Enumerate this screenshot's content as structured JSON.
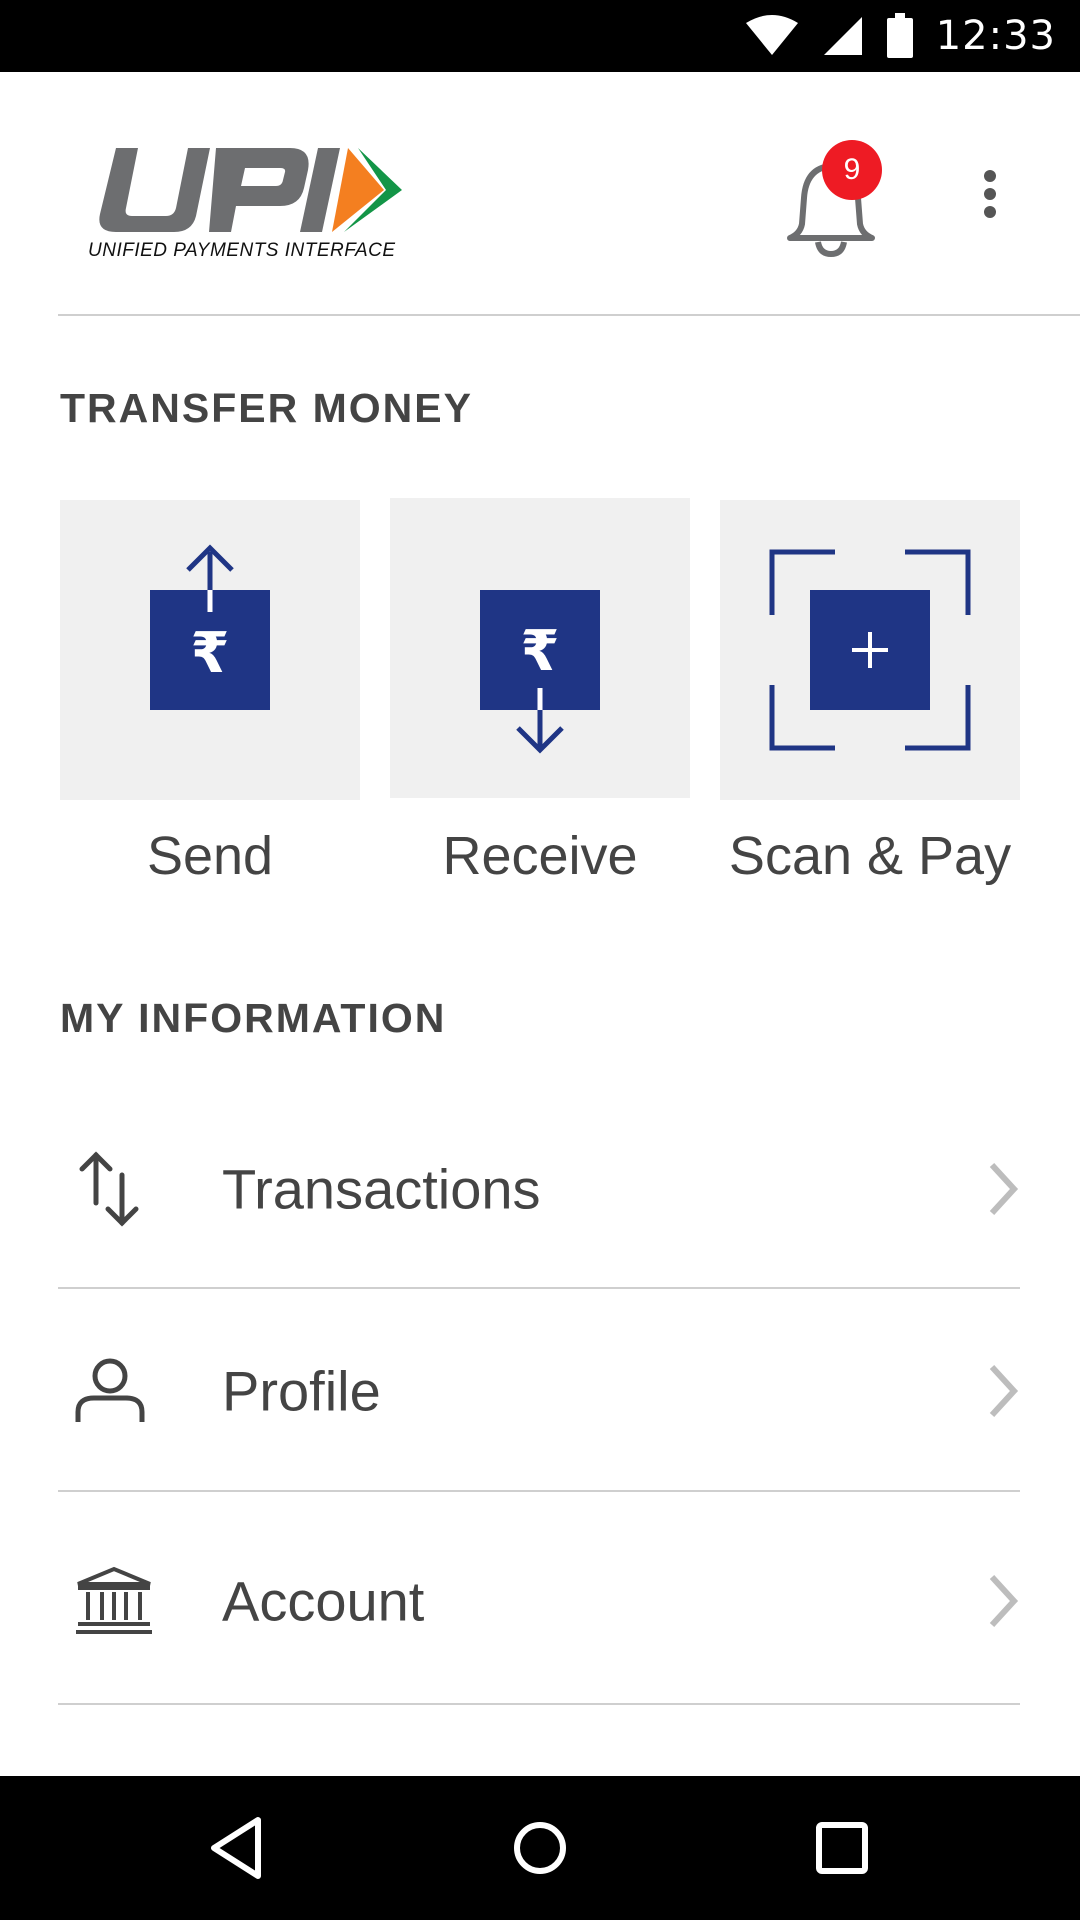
{
  "status_bar": {
    "time": "12:33",
    "icons": [
      "wifi-icon",
      "cell-signal-icon",
      "battery-icon"
    ]
  },
  "header": {
    "logo_text": "UPI",
    "logo_tagline": "UNIFIED PAYMENTS INTERFACE",
    "notification_count": "9",
    "icons": [
      "bell-icon",
      "overflow-menu-icon"
    ]
  },
  "transfer": {
    "title": "TRANSFER MONEY",
    "tiles": [
      {
        "label": "Send",
        "icon": "send-rupee-icon"
      },
      {
        "label": "Receive",
        "icon": "receive-rupee-icon"
      },
      {
        "label": "Scan & Pay",
        "icon": "scan-qr-icon"
      }
    ]
  },
  "my_information": {
    "title": "MY INFORMATION",
    "items": [
      {
        "label": "Transactions",
        "icon": "transactions-arrows-icon"
      },
      {
        "label": "Profile",
        "icon": "person-icon"
      },
      {
        "label": "Account",
        "icon": "bank-icon"
      }
    ]
  },
  "nav_bar": {
    "icons": [
      "back-icon",
      "home-icon",
      "recents-icon"
    ]
  },
  "colors": {
    "accent_blue": "#1f3585",
    "tile_bg": "#f0f0f0",
    "badge_red": "#ee1b24",
    "text_gray": "#444444",
    "logo_gray": "#6d6e70",
    "logo_orange": "#f47f20",
    "logo_green": "#139547"
  }
}
